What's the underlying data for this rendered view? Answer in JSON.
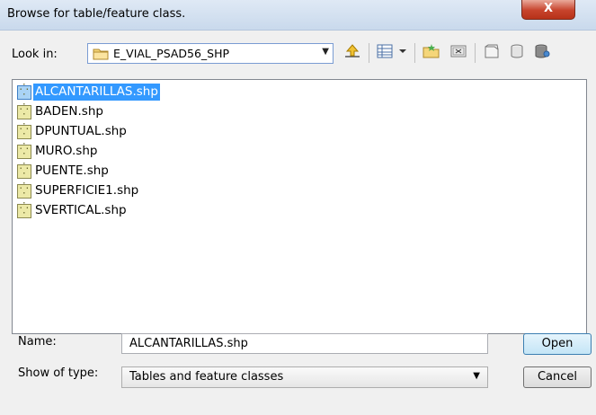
{
  "window": {
    "title": "Browse for table/feature class.",
    "close_glyph": "X"
  },
  "toolbar": {
    "look_in_label": "Look in:",
    "look_in_value": "E_VIAL_PSAD56_SHP",
    "icons": [
      "folder-icon",
      "up-one-level-icon",
      "view-menu-icon",
      "new-folder-icon",
      "connect-folder-icon",
      "catalog-icon",
      "new-file-geodatabase-icon",
      "database-icon"
    ]
  },
  "files": [
    {
      "name": "ALCANTARILLAS.shp",
      "selected": true
    },
    {
      "name": "BADEN.shp",
      "selected": false
    },
    {
      "name": "DPUNTUAL.shp",
      "selected": false
    },
    {
      "name": "MURO.shp",
      "selected": false
    },
    {
      "name": "PUENTE.shp",
      "selected": false
    },
    {
      "name": "SUPERFICIE1.shp",
      "selected": false
    },
    {
      "name": "SVERTICAL.shp",
      "selected": false
    }
  ],
  "form": {
    "name_label": "Name:",
    "name_value": "ALCANTARILLAS.shp",
    "type_label": "Show of type:",
    "type_value": "Tables and feature classes"
  },
  "buttons": {
    "open": "Open",
    "cancel": "Cancel"
  },
  "colors": {
    "selection": "#3399ff",
    "close_button": "#c7432c"
  }
}
